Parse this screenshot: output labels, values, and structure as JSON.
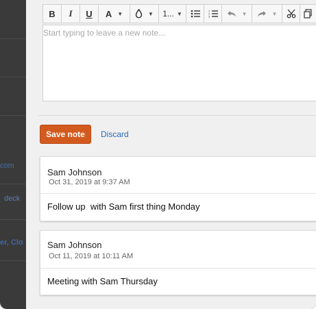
{
  "left_panel": {
    "fragments": [
      "com",
      "deck",
      "er, Clo"
    ]
  },
  "toolbar": {
    "bold": "B",
    "italic": "I",
    "underline": "U",
    "font_color": "A",
    "list_style": "1..."
  },
  "editor": {
    "placeholder": "Start typing to leave a new note..."
  },
  "actions": {
    "save_label": "Save note",
    "discard_label": "Discard"
  },
  "notes": [
    {
      "author": "Sam Johnson",
      "timestamp": "Oct 31, 2019 at 9:37 AM",
      "text": "Follow up  with Sam first thing Monday"
    },
    {
      "author": "Sam Johnson",
      "timestamp": "Oct 11, 2019 at 10:11 AM",
      "text": "Meeting with Sam Thursday"
    }
  ],
  "colors": {
    "accent": "#d35a1e",
    "link": "#2a6ab8",
    "sidebar": "#3a3a3a"
  }
}
